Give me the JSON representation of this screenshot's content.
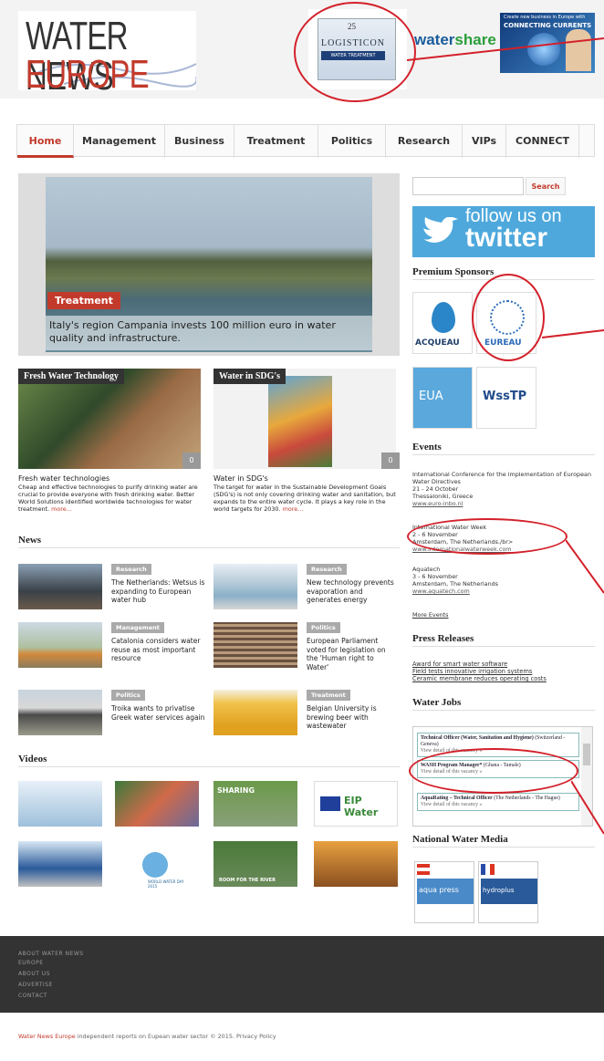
{
  "header": {
    "logo_line1": "WATER NEWS",
    "logo_line2": "EUROPE",
    "ad1_year": "25",
    "ad1_name": "LOGISTICON",
    "ad1_sub": "WATER TREATMENT",
    "ad2_part1": "water",
    "ad2_part2": "share",
    "ad3_small": "Create new business in Europe with",
    "ad3_big": "CONNECTING CURRENTS"
  },
  "nav": {
    "items": [
      {
        "label": "Home"
      },
      {
        "label": "Management"
      },
      {
        "label": "Business"
      },
      {
        "label": "Treatment"
      },
      {
        "label": "Politics"
      },
      {
        "label": "Research"
      },
      {
        "label": "VIPs"
      },
      {
        "label": "CONNECT"
      }
    ]
  },
  "hero": {
    "tag": "Treatment",
    "caption": "Italy's region Campania invests 100 million euro in water quality and infrastructure."
  },
  "cards": [
    {
      "label": "Fresh Water Technology",
      "count": "0",
      "title": "Fresh water technologies",
      "desc": "Cheap and effective technologies to purify drinking water are crucial to provide everyone with fresh drinking water. Better World Solutions identified worldwide technologies for water treatment.",
      "more": "more..."
    },
    {
      "label": "Water in SDG's",
      "count": "0",
      "title": "Water in SDG's",
      "desc": "The target for water in the Sustainable Development Goals (SDG's) is not only covering drinking water and sanitation, but expands to the entire water cycle. It plays a key role in the world targets for 2030.",
      "more": "more..."
    }
  ],
  "news": {
    "heading": "News",
    "items": [
      {
        "tag": "Research",
        "title": "The Netherlands: Wetsus is expanding to European water hub"
      },
      {
        "tag": "Research",
        "title": "New technology prevents evaporation and generates energy"
      },
      {
        "tag": "Management",
        "title": "Catalonia considers water reuse as most important resource"
      },
      {
        "tag": "Politics",
        "title": "European Parliament voted for legislation on the 'Human right to Water'"
      },
      {
        "tag": "Politics",
        "title": "Troika wants to privatise Greek water services again"
      },
      {
        "tag": "Treatment",
        "title": "Belgian University is brewing beer with wastewater"
      }
    ]
  },
  "videos": {
    "heading": "Videos",
    "v3_text": "SHARING",
    "v4_text": "EIP Water",
    "v6_text": "WORLD WATER DAY 2015",
    "v7_text": "ROOM FOR THE RIVER"
  },
  "sidebar": {
    "search_button": "Search",
    "twitter_line1": "follow us on",
    "twitter_line2": "twitter",
    "sponsors_heading": "Premium Sponsors",
    "sponsor1": "ACQUEAU",
    "sponsor2": "EUREAU",
    "sponsor3": "EUA",
    "sponsor4": "WssTP",
    "events_heading": "Events",
    "events": [
      {
        "title": "International Conference for the implementation of European Water Directives",
        "date": "21 - 24 October",
        "place": "Thessaloniki, Greece",
        "link": "www.euro-inbo.nl"
      },
      {
        "title": "International Water Week",
        "date": "2 - 6 November",
        "place": "Amsterdam, The Netherlands./br>",
        "link": "www.internationalwaterweek.com"
      },
      {
        "title": "Aquatech",
        "date": "3 - 6 November",
        "place": "Amsterdam, The Netherlands",
        "link": "www.aquatech.com"
      }
    ],
    "more_events": "More Events",
    "press_heading": "Press Releases",
    "press": [
      "Award for smart water software",
      "Field tests innovative irrigation systems",
      "Ceramic membrane reduces operating costs"
    ],
    "jobs_heading": "Water Jobs",
    "jobs": [
      {
        "title": "Technical Officer (Water, Sanitation and Hygiene)",
        "loc": "(Switzerland - Geneva)",
        "link": "View detail of this vacancy »"
      },
      {
        "title": "WASH Program Manager*",
        "loc": "(Ghana - Tamale)",
        "link": "View detail of this vacancy »"
      },
      {
        "title": "AquaRating – Technical Officer",
        "loc": "(The Netherlands - The Hague)",
        "link": "View detail of this vacancy »"
      }
    ],
    "media_heading": "National Water Media",
    "media1": "aqua press",
    "media2": "hydroplus"
  },
  "footer": {
    "links": [
      "ABOUT WATER NEWS",
      "EUROPE",
      "ABOUT US",
      "ADVERTISE",
      "CONTACT"
    ],
    "brand": "Water News Europe",
    "copy": " independent reports on Eupean water sector © 2015.",
    "privacy": "Privacy Policy"
  },
  "colors": {
    "accent": "#c23a2c",
    "annotation": "#d3202a",
    "twitter": "#4ea8dc",
    "footer_bg": "#333333"
  }
}
